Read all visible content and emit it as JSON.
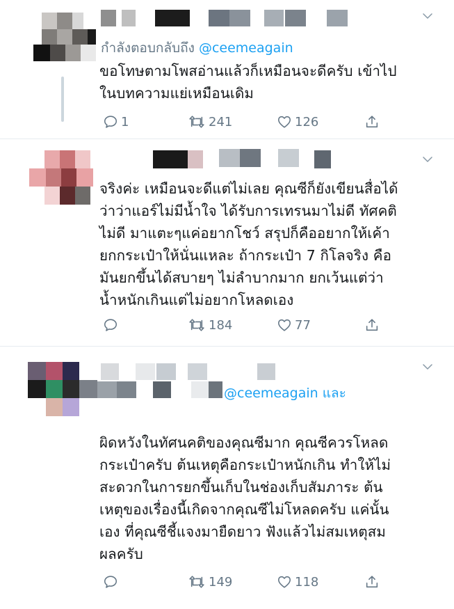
{
  "tweets": [
    {
      "reply_prefix": "กำลังตอบกลับถึง",
      "reply_handle": "@ceemeagain",
      "text": "ขอโทษตามโพสอ่านแล้วก็เหมือนจะดีครับ เข้าไป\nในบทความแย่เหมือนเดิม",
      "replies": "1",
      "retweets": "241",
      "likes": "126"
    },
    {
      "text": "จริงค่ะ เหมือนจะดีแต่ไม่เลย คุณซีก็ยังเขียนสื่อได้\nว่าว่าแอร์ไม่มีน้ำใจ ได้รับการเทรนมาไม่ดี ทัศคติ\nไม่ดี มาแตะๆแค่อยากโชว์ สรุปก็คืออยากให้เค้า\nยกกระเป๋าให้นั่นแหละ ถ้ากระเป๋า 7 กิโลจริง คือ\nมันยกขึ้นได้สบายๆ ไม่ลำบากมาก ยกเว้นแต่ว่า\nน้ำหนักเกินแต่ไม่อยากโหลดเอง",
      "replies": "",
      "retweets": "184",
      "likes": "77"
    },
    {
      "reply_handle": "@ceemeagain",
      "reply_suffix": "และ",
      "text": "ผิดหวังในทัศนคติของคุณซีมาก คุณซีควรโหลด\nกระเป๋าครับ ต้นเหตุคือกระเป๋าหนักเกิน ทำให้ไม่\nสะดวกในการยกขึ้นเก็บในช่องเก็บสัมภาระ ต้น\nเหตุของเรื่องนี้เกิดจากคุณซีไม่โหลดครับ แค่นั้น\nเอง ที่คุณซีชี้แจงมายืดยาว ฟังแล้วไม่สมเหตุสม\nผลครับ",
      "replies": "",
      "retweets": "149",
      "likes": "118"
    }
  ],
  "colors": {
    "text": "#14171a",
    "secondary": "#657786",
    "link": "#1da1f2",
    "divider": "#e6ecf0"
  },
  "icons": [
    "reply-icon",
    "retweet-icon",
    "like-icon",
    "share-icon",
    "chevron-down-icon"
  ]
}
